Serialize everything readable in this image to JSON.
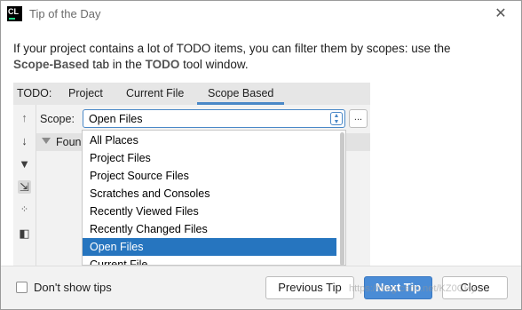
{
  "window": {
    "app_icon_text": "CL",
    "title": "Tip of the Day",
    "close_glyph": "✕"
  },
  "tip": {
    "line1": "If your project contains a lot of TODO items, you can filter them by scopes: use the",
    "bold1": "Scope-Based",
    "mid": " tab in the ",
    "bold2": "TODO",
    "end": " tool window."
  },
  "todo_panel": {
    "prefix": "TODO:",
    "tabs": [
      {
        "label": "Project",
        "selected": false
      },
      {
        "label": "Current File",
        "selected": false
      },
      {
        "label": "Scope Based",
        "selected": true
      }
    ],
    "left_icons": [
      "arrow-up-icon",
      "arrow-down-icon",
      "filter-icon",
      "autoscroll-icon",
      "group-icon",
      "preview-icon"
    ],
    "scope_label": "Scope:",
    "scope_value": "Open Files",
    "browse_label": "...",
    "found_text": "Foun"
  },
  "dropdown": {
    "items": [
      "All Places",
      "Project Files",
      "Project Source Files",
      "Scratches and Consoles",
      "Recently Viewed Files",
      "Recently Changed Files",
      "Open Files",
      "Current File"
    ],
    "selected_index": 6
  },
  "footer": {
    "dont_show_label": "Don't show tips",
    "dont_show_checked": false,
    "previous_label": "Previous Tip",
    "next_label": "Next Tip",
    "close_label": "Close",
    "watermark": "https://blog.csdn.net/KZ0CHy"
  },
  "colors": {
    "accent": "#4a88c7",
    "selection": "#2675bf",
    "primary_button": "#4a8cd6"
  }
}
